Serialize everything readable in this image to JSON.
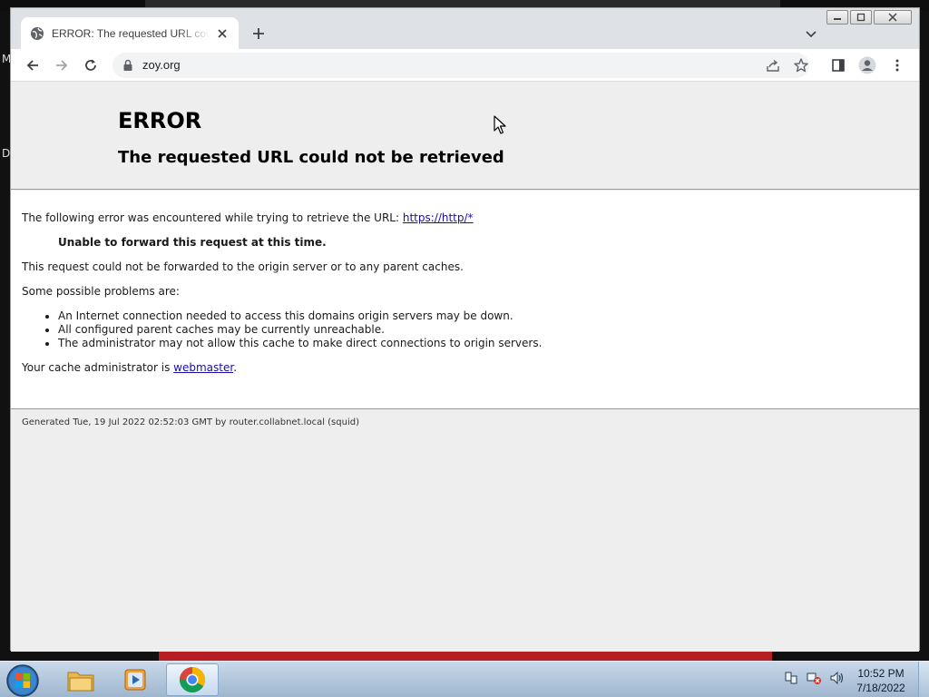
{
  "desktop": {
    "side_letters": [
      "M",
      "D"
    ]
  },
  "browser": {
    "tab": {
      "title": "ERROR: The requested URL could not be retrieved"
    },
    "omnibox": {
      "url": "zoy.org"
    }
  },
  "page": {
    "title": "ERROR",
    "subtitle": "The requested URL could not be retrieved",
    "intro_text": "The following error was encountered while trying to retrieve the URL: ",
    "intro_link": "https://http/*",
    "error_message": "Unable to forward this request at this time.",
    "explanation": "This request could not be forwarded to the origin server or to any parent caches.",
    "problems_heading": "Some possible problems are:",
    "problems": [
      "An Internet connection needed to access this domains origin servers may be down.",
      "All configured parent caches may be currently unreachable.",
      "The administrator may not allow this cache to make direct connections to origin servers."
    ],
    "admin_text": "Your cache administrator is ",
    "admin_link": "webmaster",
    "admin_suffix": ".",
    "footer": "Generated Tue, 19 Jul 2022 02:52:03 GMT by router.collabnet.local (squid)"
  },
  "taskbar": {
    "clock_time": "10:52 PM",
    "clock_date": "7/18/2022"
  },
  "colors": {
    "link": "#1a0dab",
    "tabstrip": "#dee1e6",
    "page_bg": "#eeeeee",
    "taskbar": "#9fb6ce"
  }
}
